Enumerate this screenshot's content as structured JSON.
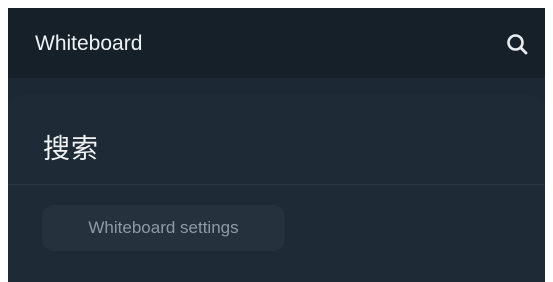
{
  "search": {
    "value": "Whiteboard",
    "icon": "search-icon"
  },
  "results": {
    "title": "搜索",
    "chips": [
      {
        "label": "Whiteboard settings"
      }
    ]
  },
  "colors": {
    "background": "#1c2833",
    "search_bar": "#152029",
    "chip": "#25313c"
  }
}
